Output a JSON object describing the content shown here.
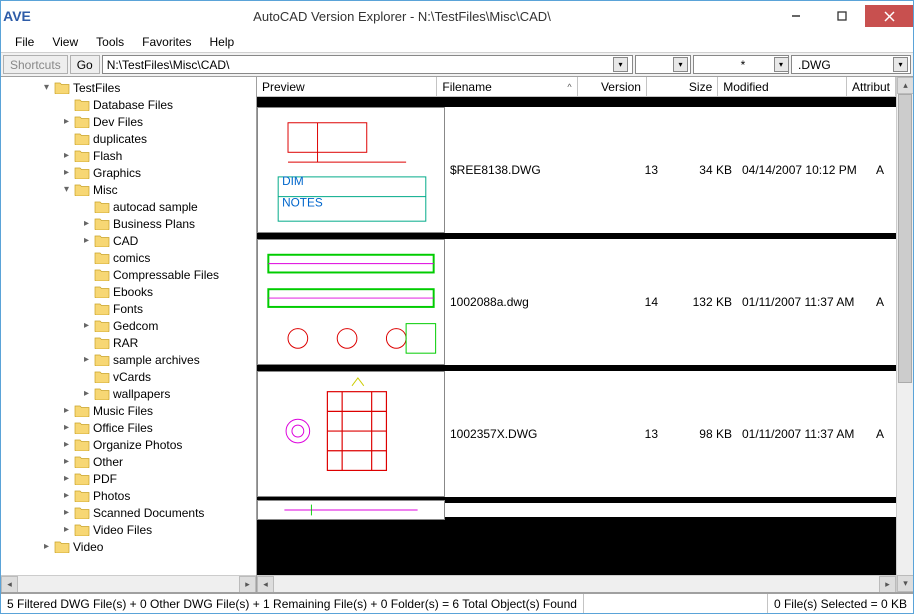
{
  "window": {
    "logo_text": "AVE",
    "title": "AutoCAD Version Explorer - N:\\TestFiles\\Misc\\CAD\\"
  },
  "menu": [
    "File",
    "View",
    "Tools",
    "Favorites",
    "Help"
  ],
  "toolbar": {
    "shortcuts_label": "Shortcuts",
    "go_label": "Go",
    "path": "N:\\TestFiles\\Misc\\CAD\\",
    "filter1": "",
    "filter2": "*",
    "filter3": ".DWG"
  },
  "tree": [
    {
      "depth": 0,
      "exp": "▾",
      "label": "TestFiles"
    },
    {
      "depth": 1,
      "exp": "",
      "label": "Database Files"
    },
    {
      "depth": 1,
      "exp": "▸",
      "label": "Dev Files"
    },
    {
      "depth": 1,
      "exp": "",
      "label": "duplicates"
    },
    {
      "depth": 1,
      "exp": "▸",
      "label": "Flash"
    },
    {
      "depth": 1,
      "exp": "▸",
      "label": "Graphics"
    },
    {
      "depth": 1,
      "exp": "▾",
      "label": "Misc"
    },
    {
      "depth": 2,
      "exp": "",
      "label": "autocad sample"
    },
    {
      "depth": 2,
      "exp": "▸",
      "label": "Business Plans"
    },
    {
      "depth": 2,
      "exp": "▸",
      "label": "CAD"
    },
    {
      "depth": 2,
      "exp": "",
      "label": "comics"
    },
    {
      "depth": 2,
      "exp": "",
      "label": "Compressable Files"
    },
    {
      "depth": 2,
      "exp": "",
      "label": "Ebooks"
    },
    {
      "depth": 2,
      "exp": "",
      "label": "Fonts"
    },
    {
      "depth": 2,
      "exp": "▸",
      "label": "Gedcom"
    },
    {
      "depth": 2,
      "exp": "",
      "label": "RAR"
    },
    {
      "depth": 2,
      "exp": "▸",
      "label": "sample archives"
    },
    {
      "depth": 2,
      "exp": "",
      "label": "vCards"
    },
    {
      "depth": 2,
      "exp": "▸",
      "label": "wallpapers"
    },
    {
      "depth": 1,
      "exp": "▸",
      "label": "Music Files"
    },
    {
      "depth": 1,
      "exp": "▸",
      "label": "Office Files"
    },
    {
      "depth": 1,
      "exp": "▸",
      "label": "Organize Photos"
    },
    {
      "depth": 1,
      "exp": "▸",
      "label": "Other"
    },
    {
      "depth": 1,
      "exp": "▸",
      "label": "PDF"
    },
    {
      "depth": 1,
      "exp": "▸",
      "label": "Photos"
    },
    {
      "depth": 1,
      "exp": "▸",
      "label": "Scanned Documents"
    },
    {
      "depth": 1,
      "exp": "▸",
      "label": "Video Files"
    },
    {
      "depth": 0,
      "exp": "▸",
      "label": "Video"
    }
  ],
  "columns": {
    "preview": "Preview",
    "filename": "Filename",
    "version": "Version",
    "size": "Size",
    "modified": "Modified",
    "attrib": "Attribut"
  },
  "sort_indicator": "^",
  "rows": [
    {
      "filename": "$REE8138.DWG",
      "version": "13",
      "size": "34 KB",
      "modified": "04/14/2007 10:12 PM",
      "attrib": "A"
    },
    {
      "filename": "1002088a.dwg",
      "version": "14",
      "size": "132 KB",
      "modified": "01/11/2007 11:37 AM",
      "attrib": "A"
    },
    {
      "filename": "1002357X.DWG",
      "version": "13",
      "size": "98 KB",
      "modified": "01/11/2007 11:37 AM",
      "attrib": "A"
    }
  ],
  "status": {
    "left": "5 Filtered DWG File(s) + 0 Other DWG File(s) + 1 Remaining File(s) + 0 Folder(s)  =  6 Total Object(s) Found",
    "right": "0 File(s) Selected = 0 KB"
  }
}
